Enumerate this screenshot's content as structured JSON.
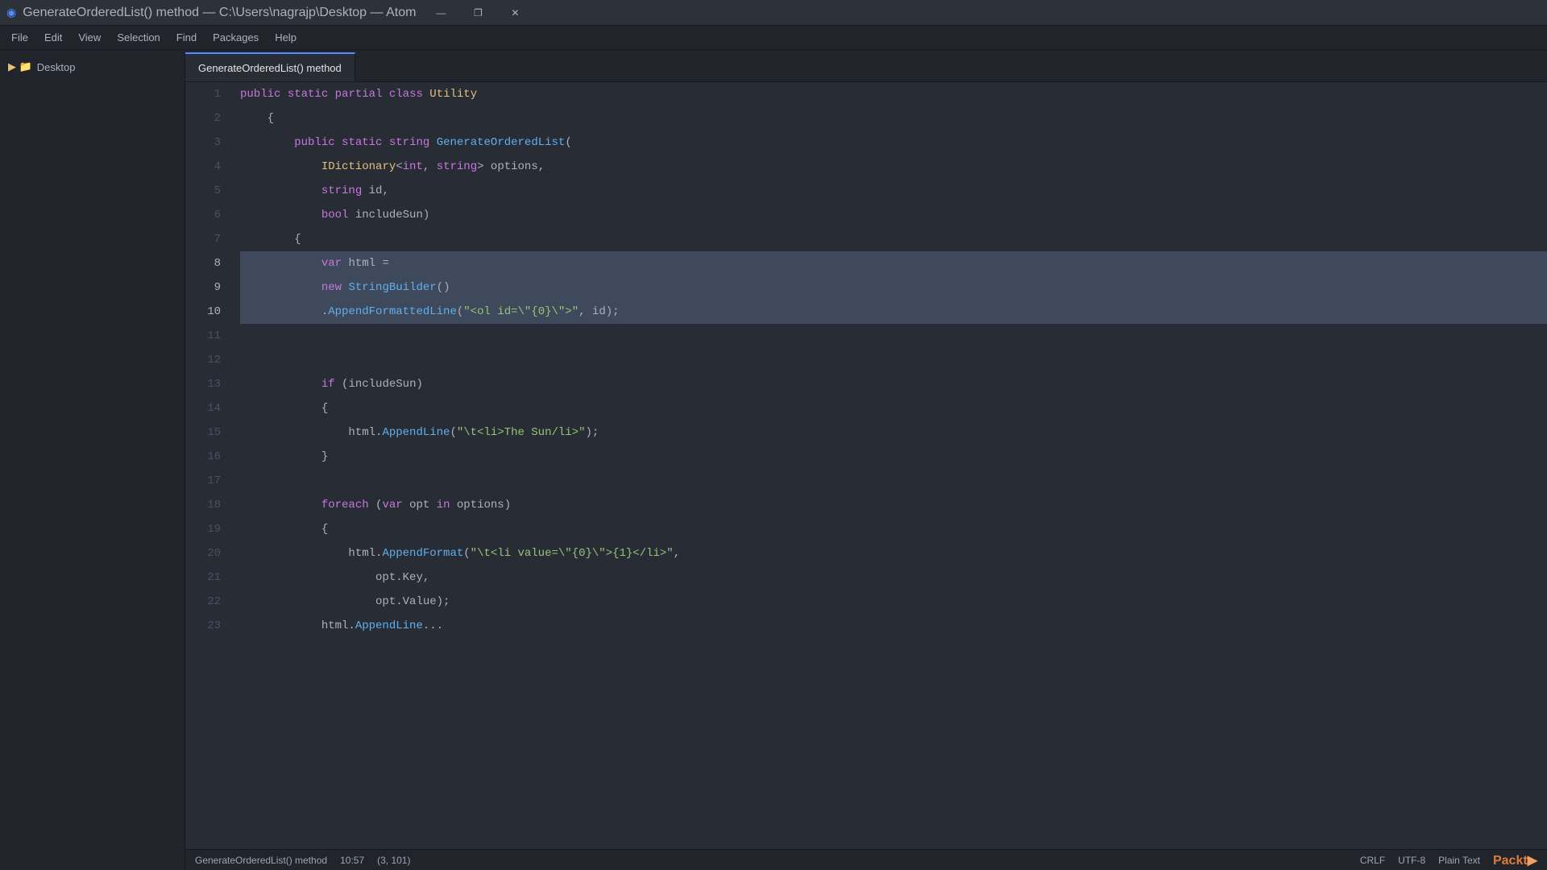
{
  "titleBar": {
    "title": "GenerateOrderedList() method — C:\\Users\\nagrajp\\Desktop — Atom",
    "appIcon": "◉"
  },
  "windowControls": {
    "minimize": "—",
    "maximize": "❐",
    "close": "✕"
  },
  "menuBar": {
    "items": [
      "File",
      "Edit",
      "View",
      "Selection",
      "Find",
      "Packages",
      "Help"
    ]
  },
  "sidebar": {
    "items": [
      {
        "label": "Desktop",
        "icon": "📁"
      }
    ]
  },
  "tab": {
    "label": "GenerateOrderedList() method"
  },
  "statusBar": {
    "file": "GenerateOrderedList() method",
    "time": "10:57",
    "position": "(3, 101)",
    "lineEnding": "CRLF",
    "encoding": "UTF-8",
    "syntax": "Plain Text",
    "logoText": "Packt",
    "logoArrow": "▶"
  },
  "lines": [
    {
      "num": 1,
      "content": "public static partial class Utility"
    },
    {
      "num": 2,
      "content": "    {"
    },
    {
      "num": 3,
      "content": "        public static string GenerateOrderedList("
    },
    {
      "num": 4,
      "content": "            IDictionary<int, string> options,"
    },
    {
      "num": 5,
      "content": "            string id,"
    },
    {
      "num": 6,
      "content": "            bool includeSun)"
    },
    {
      "num": 7,
      "content": "        {"
    },
    {
      "num": 8,
      "content": "            var html =",
      "selected": true
    },
    {
      "num": 9,
      "content": "            new StringBuilder()",
      "selected": true
    },
    {
      "num": 10,
      "content": "            .AppendFormattedLine(\"<ol id=\\\"{0}\\\">\", id);",
      "selected": true
    },
    {
      "num": 11,
      "content": ""
    },
    {
      "num": 12,
      "content": ""
    },
    {
      "num": 13,
      "content": "            if (includeSun)"
    },
    {
      "num": 14,
      "content": "            {"
    },
    {
      "num": 15,
      "content": "                html.AppendLine(\"\\t<li>The Sun/li>\");"
    },
    {
      "num": 16,
      "content": "            }"
    },
    {
      "num": 17,
      "content": ""
    },
    {
      "num": 18,
      "content": "            foreach (var opt in options)"
    },
    {
      "num": 19,
      "content": "            {"
    },
    {
      "num": 20,
      "content": "                html.AppendFormat(\"\\t<li value=\\\"{0}\\\">{1}</li>\","
    },
    {
      "num": 21,
      "content": "                    opt.Key,"
    },
    {
      "num": 22,
      "content": "                    opt.Value);"
    },
    {
      "num": 23,
      "content": "..."
    }
  ]
}
